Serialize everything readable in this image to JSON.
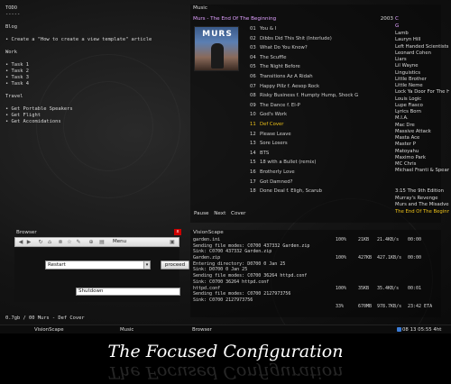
{
  "todo": {
    "lines": [
      "TODO",
      "-----",
      "",
      "Blog",
      "",
      "• Create a \"How to create a view template\" article",
      "",
      "Work",
      "",
      "• Task 1",
      "• Task 2",
      "• Task 3",
      "• Task 4",
      "",
      "Travel",
      "",
      "• Get Portable Speakers",
      "• Get Flight",
      "• Get Accomidations"
    ]
  },
  "music": {
    "window_title": "Music",
    "album_heading": "Murs - The End Of The Beginning",
    "year": "2003",
    "cover_text": "MURS",
    "tracks": [
      {
        "n": "01",
        "title": "You & I"
      },
      {
        "n": "02",
        "title": "Dibbs Did This Shit (Interlude)"
      },
      {
        "n": "03",
        "title": "What Do You Know?"
      },
      {
        "n": "04",
        "title": "The Scuffle"
      },
      {
        "n": "05",
        "title": "The Night Before"
      },
      {
        "n": "06",
        "title": "Transitions Az A Ridah"
      },
      {
        "n": "07",
        "title": "Happy Pillz f. Aesop Rock"
      },
      {
        "n": "08",
        "title": "Risky Business f. Humpty Hump, Shock G"
      },
      {
        "n": "09",
        "title": "The Dance f. El-P"
      },
      {
        "n": "10",
        "title": "God's Work"
      },
      {
        "n": "11",
        "title": "Def Cover"
      },
      {
        "n": "12",
        "title": "Please Leave"
      },
      {
        "n": "13",
        "title": "Sore Losers"
      },
      {
        "n": "14",
        "title": "BTS"
      },
      {
        "n": "15",
        "title": "18 with a Bullet (remix)"
      },
      {
        "n": "16",
        "title": "Brotherly Love"
      },
      {
        "n": "17",
        "title": "Got Damned?"
      },
      {
        "n": "18",
        "title": "Done Deal f. Eligh, Scarub"
      }
    ],
    "current_track_index": 10,
    "letters": [
      "C",
      "G"
    ],
    "artists": [
      "Lamb",
      "Lauryn Hill",
      "Left Handed Scientists",
      "Leonard Cohen",
      "Liars",
      "Lil Wayne",
      "Linguistics",
      "Little Brother",
      "Little Neme",
      "Lock Ya Door For The Hi",
      "Louis Logic",
      "Lupe Fiasco",
      "Lyrics Born",
      "M.I.A.",
      "Mac Dre",
      "Massive Attack",
      "Masta Ace",
      "Master P",
      "Matoyahu",
      "Maximo Park",
      "MC Chris",
      "Michael Franti & Spearh"
    ],
    "albums": [
      "3:15 The 9th Edition",
      "Murray's Revenge",
      "Murs and The Misadvent",
      "The End Of The Beginnin"
    ],
    "current_album_index": 3,
    "controls": {
      "pause": "Pause",
      "next": "Next",
      "cover": "Cover"
    },
    "accent_color": "#e0a0ff",
    "current_color": "#f0c419"
  },
  "browser": {
    "window_title": "Browser",
    "menu_label": "Menu",
    "restart_value": "Restart",
    "proceed_label": "proceed",
    "shutdown_value": "Shutdown",
    "close_glyph": "x"
  },
  "vision": {
    "window_title": "VisionScape",
    "lines": [
      {
        "text": "garden.ini",
        "pct": "100%",
        "size": "21KB",
        "rate": "21.4KB/s",
        "time": "00:00"
      },
      {
        "text": "Sending file modes: C0700 437332 Garden.zip"
      },
      {
        "text": "Sink: C0700 437332 Garden.zip"
      },
      {
        "text": "Garden.zip",
        "pct": "100%",
        "size": "427KB",
        "rate": "427.1KB/s",
        "time": "00:00"
      },
      {
        "text": "Entering directory: D0700 0 Jan 25"
      },
      {
        "text": "Sink: D0700 0 Jan 25"
      },
      {
        "text": "Sending file modes: C0700 36264 httpd.conf"
      },
      {
        "text": "Sink: C0700 36264 httpd.conf"
      },
      {
        "text": "httpd.conf",
        "pct": "100%",
        "size": "35KB",
        "rate": "35.4KB/s",
        "time": "00:01"
      },
      {
        "text": "Sending file modes: C0700 2127973756"
      },
      {
        "text": "Sink: C0700 2127973756"
      },
      {
        "text": "",
        "pct": "33%",
        "size": "670MB",
        "rate": "978.7KB/s",
        "time": "23:42 ETA"
      }
    ]
  },
  "statusline": "0.7gb / 00 Murs - Def Cover",
  "taskbar": {
    "items": [
      "VisionScape",
      "Music",
      "Browser"
    ],
    "clock": "08 13 05:55 4ht"
  },
  "caption": "The Focused Configuration"
}
